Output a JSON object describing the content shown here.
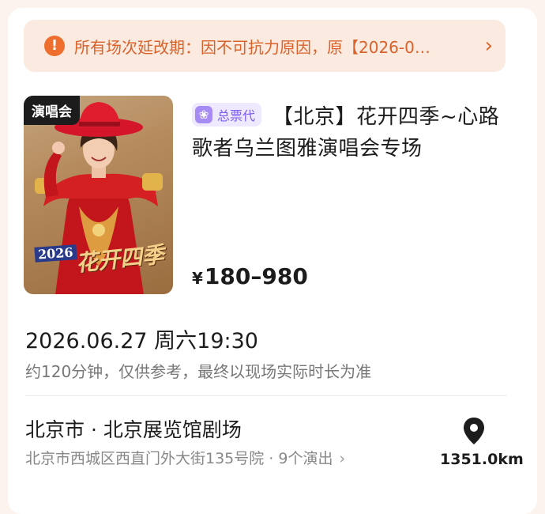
{
  "notice": {
    "icon": "exclamation-icon",
    "text": "所有场次延改期：因不可抗力原因，原【2026-0…",
    "accent": "#ee6f2d"
  },
  "poster": {
    "tag": "演唱会",
    "year_art": "2026",
    "title_art": "花开四季"
  },
  "event": {
    "badge_label": "总票代",
    "badge_icon": "flower-icon",
    "title": "【北京】花开四季~心路歌者乌兰图雅演唱会专场",
    "price_symbol": "¥",
    "price_range": "180–980"
  },
  "schedule": {
    "datetime": "2026.06.27 周六19:30",
    "duration_note": "约120分钟，仅供参考，最终以现场实际时长为准"
  },
  "venue": {
    "name": "北京市 · 北京展览馆剧场",
    "address": "北京市西城区西直门外大街135号院 · 9个演出",
    "distance": "1351.0km",
    "pin_icon": "location-pin-icon"
  }
}
